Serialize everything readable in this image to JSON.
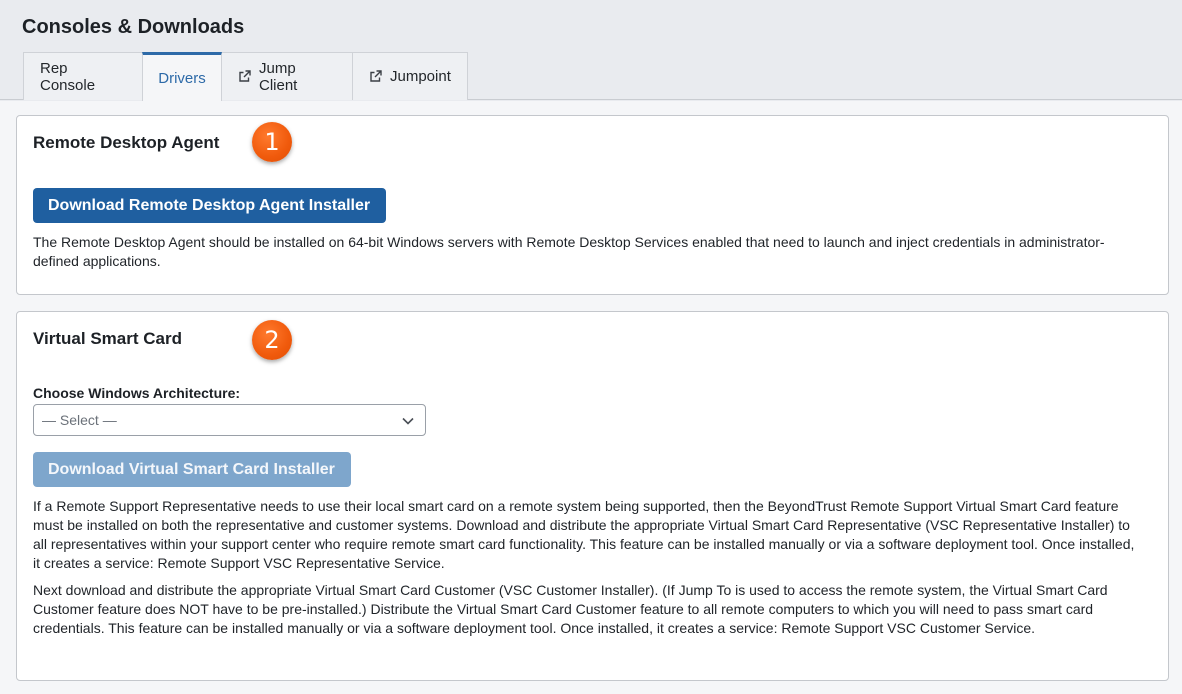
{
  "header": {
    "title": "Consoles & Downloads",
    "tabs": [
      {
        "label": "Rep Console",
        "icon": null,
        "active": false
      },
      {
        "label": "Drivers",
        "icon": null,
        "active": true
      },
      {
        "label": "Jump Client",
        "icon": "external-link-icon",
        "active": false
      },
      {
        "label": "Jumpoint",
        "icon": "external-link-icon",
        "active": false
      }
    ]
  },
  "sections": {
    "remote_desktop_agent": {
      "title": "Remote Desktop Agent",
      "badge": "1",
      "button_label": "Download Remote Desktop Agent Installer",
      "description": "The Remote Desktop Agent should be installed on 64-bit Windows servers with Remote Desktop Services enabled that need to launch and inject credentials in administrator-defined applications."
    },
    "virtual_smart_card": {
      "title": "Virtual Smart Card",
      "badge": "2",
      "field_label": "Choose Windows Architecture:",
      "select_value": "— Select —",
      "button_label": "Download Virtual Smart Card Installer",
      "button_disabled": true,
      "description_1": "If a Remote Support Representative needs to use their local smart card on a remote system being supported, then the BeyondTrust Remote Support Virtual Smart Card feature must be installed on both the representative and customer systems. Download and distribute the appropriate Virtual Smart Card Representative (VSC Representative Installer) to all representatives within your support center who require remote smart card functionality. This feature can be installed manually or via a software deployment tool. Once installed, it creates a service: Remote Support VSC Representative Service.",
      "description_2": "Next download and distribute the appropriate Virtual Smart Card Customer (VSC Customer Installer). (If Jump To is used to access the remote system, the Virtual Smart Card Customer feature does NOT have to be pre-installed.) Distribute the Virtual Smart Card Customer feature to all remote computers to which you will need to pass smart card credentials. This feature can be installed manually or via a software deployment tool. Once installed, it creates a service: Remote Support VSC Customer Service."
    }
  },
  "colors": {
    "accent": "#2d6aa8",
    "button_primary": "#1f5fa0",
    "button_disabled": "#7ea6cc",
    "badge": "#f05a0c"
  }
}
